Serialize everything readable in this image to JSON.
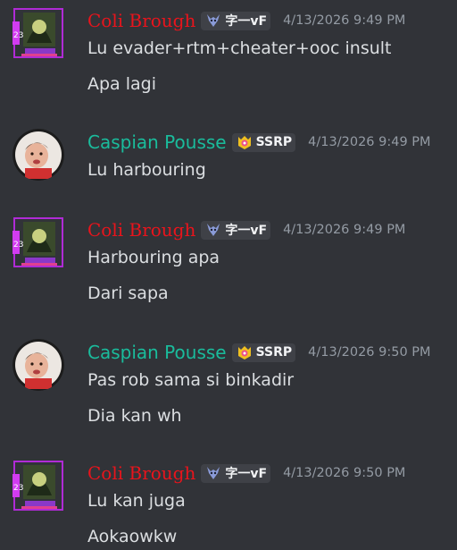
{
  "messages": [
    {
      "author": "Coli Brough",
      "tag": "字一vF",
      "timestamp": "4/13/2026 9:49 PM",
      "lines": [
        "Lu evader+rtm+cheater+ooc insult",
        "Apa lagi"
      ]
    },
    {
      "author": "Caspian Pousse",
      "tag": "SSRP",
      "timestamp": "4/13/2026 9:49 PM",
      "lines": [
        "Lu harbouring"
      ]
    },
    {
      "author": "Coli Brough",
      "tag": "字一vF",
      "timestamp": "4/13/2026 9:49 PM",
      "lines": [
        "Harbouring apa",
        "Dari sapa"
      ]
    },
    {
      "author": "Caspian Pousse",
      "tag": "SSRP",
      "timestamp": "4/13/2026 9:50 PM",
      "lines": [
        "Pas rob sama si binkadir",
        "Dia kan wh"
      ]
    },
    {
      "author": "Coli Brough",
      "tag": "字一vF",
      "timestamp": "4/13/2026 9:50 PM",
      "lines": [
        "Lu kan juga",
        "Aokaowkw"
      ]
    }
  ],
  "colors": {
    "background": "#313338",
    "coli_name": "#e8141c",
    "caspian_name": "#1abc9c",
    "text": "#dbdee1",
    "timestamp": "#949ba4"
  },
  "icons": {
    "coli_tag_icon": "goat-head-icon",
    "caspian_tag_icon": "crown-shield-icon"
  }
}
